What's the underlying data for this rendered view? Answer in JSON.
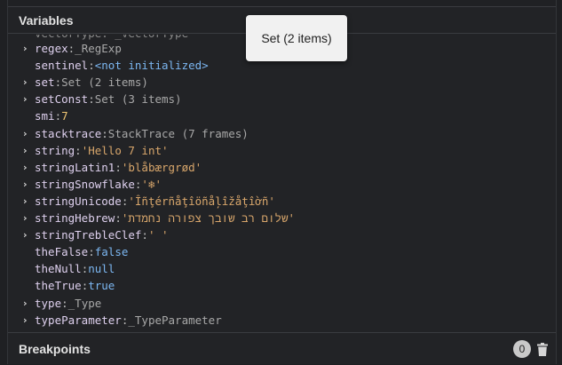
{
  "variables_panel": {
    "title": "Variables",
    "rows": [
      {
        "has_chevron": true,
        "name": "regex",
        "kind": "type",
        "value": "_RegExp"
      },
      {
        "has_chevron": false,
        "name": "sentinel",
        "kind": "kw",
        "value": "<not initialized>"
      },
      {
        "has_chevron": true,
        "name": "set",
        "kind": "type",
        "value": "Set (2 items)"
      },
      {
        "has_chevron": true,
        "name": "setConst",
        "kind": "type",
        "value": "Set (3 items)"
      },
      {
        "has_chevron": false,
        "name": "smi",
        "kind": "num",
        "value": "7"
      },
      {
        "has_chevron": true,
        "name": "stacktrace",
        "kind": "type",
        "value": "StackTrace (7 frames)"
      },
      {
        "has_chevron": true,
        "name": "string",
        "kind": "str",
        "value": "'Hello 7 int'"
      },
      {
        "has_chevron": true,
        "name": "stringLatin1",
        "kind": "str",
        "value": "'blåbærgrød'"
      },
      {
        "has_chevron": true,
        "name": "stringSnowflake",
        "kind": "str",
        "value": "'❄'"
      },
      {
        "has_chevron": true,
        "name": "stringUnicode",
        "kind": "str",
        "value": "'Îñţérñåţîöñåļîžåţîờñ'"
      },
      {
        "has_chevron": true,
        "name": "stringHebrew",
        "kind": "str",
        "value": "'שלום רב שובך צפורה נחמדת'"
      },
      {
        "has_chevron": true,
        "name": "stringTrebleClef",
        "kind": "str",
        "value": "' '"
      },
      {
        "has_chevron": false,
        "name": "theFalse",
        "kind": "kw",
        "value": "false"
      },
      {
        "has_chevron": false,
        "name": "theNull",
        "kind": "kw",
        "value": "null"
      },
      {
        "has_chevron": false,
        "name": "theTrue",
        "kind": "kw",
        "value": "true"
      },
      {
        "has_chevron": true,
        "name": "type",
        "kind": "type",
        "value": "_Type"
      },
      {
        "has_chevron": true,
        "name": "typeParameter",
        "kind": "type",
        "value": "_TypeParameter"
      }
    ]
  },
  "tooltip": {
    "text": "Set (2 items)"
  },
  "breakpoints_panel": {
    "title": "Breakpoints",
    "count": "0",
    "delete_icon": "trash-icon"
  },
  "colors": {
    "background": "#222326",
    "variable_name": "#dfd1ef",
    "string_value": "#d8a66b",
    "keyword_value": "#7cb7f2",
    "number_value": "#f0c674",
    "type_value": "#a8a8a8"
  }
}
